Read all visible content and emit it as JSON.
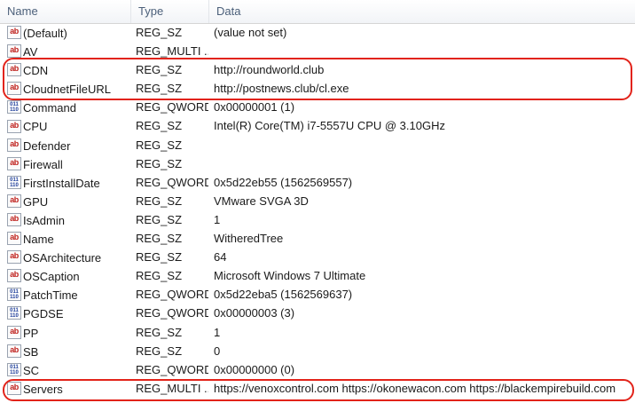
{
  "columns": {
    "name": "Name",
    "type": "Type",
    "data": "Data"
  },
  "rows": [
    {
      "name": "(Default)",
      "type": "REG_SZ",
      "data": "(value not set)",
      "icon": "string-value-icon"
    },
    {
      "name": "AV",
      "type": "REG_MULTI ...",
      "data": "",
      "icon": "string-value-icon"
    },
    {
      "name": "CDN",
      "type": "REG_SZ",
      "data": "http://roundworld.club",
      "icon": "string-value-icon"
    },
    {
      "name": "CloudnetFileURL",
      "type": "REG_SZ",
      "data": "http://postnews.club/cl.exe",
      "icon": "string-value-icon"
    },
    {
      "name": "Command",
      "type": "REG_QWORD",
      "data": "0x00000001 (1)",
      "icon": "binary-value-icon"
    },
    {
      "name": "CPU",
      "type": "REG_SZ",
      "data": "Intel(R) Core(TM) i7-5557U CPU @ 3.10GHz",
      "icon": "string-value-icon"
    },
    {
      "name": "Defender",
      "type": "REG_SZ",
      "data": "",
      "icon": "string-value-icon"
    },
    {
      "name": "Firewall",
      "type": "REG_SZ",
      "data": "",
      "icon": "string-value-icon"
    },
    {
      "name": "FirstInstallDate",
      "type": "REG_QWORD",
      "data": "0x5d22eb55 (1562569557)",
      "icon": "binary-value-icon"
    },
    {
      "name": "GPU",
      "type": "REG_SZ",
      "data": "VMware SVGA 3D",
      "icon": "string-value-icon"
    },
    {
      "name": "IsAdmin",
      "type": "REG_SZ",
      "data": "1",
      "icon": "string-value-icon"
    },
    {
      "name": "Name",
      "type": "REG_SZ",
      "data": "WitheredTree",
      "icon": "string-value-icon"
    },
    {
      "name": "OSArchitecture",
      "type": "REG_SZ",
      "data": "64",
      "icon": "string-value-icon"
    },
    {
      "name": "OSCaption",
      "type": "REG_SZ",
      "data": "Microsoft Windows 7 Ultimate",
      "icon": "string-value-icon"
    },
    {
      "name": "PatchTime",
      "type": "REG_QWORD",
      "data": "0x5d22eba5 (1562569637)",
      "icon": "binary-value-icon"
    },
    {
      "name": "PGDSE",
      "type": "REG_QWORD",
      "data": "0x00000003 (3)",
      "icon": "binary-value-icon"
    },
    {
      "name": "PP",
      "type": "REG_SZ",
      "data": "1",
      "icon": "string-value-icon"
    },
    {
      "name": "SB",
      "type": "REG_SZ",
      "data": "0",
      "icon": "string-value-icon"
    },
    {
      "name": "SC",
      "type": "REG_QWORD",
      "data": "0x00000000 (0)",
      "icon": "binary-value-icon"
    },
    {
      "name": "Servers",
      "type": "REG_MULTI ...",
      "data": "https://venoxcontrol.com https://okonewacon.com https://blackempirebuild.com",
      "icon": "string-value-icon"
    }
  ],
  "highlight_color": "#e2231a",
  "icon_glyphs": {
    "string": "ab",
    "binary": "011 110"
  }
}
